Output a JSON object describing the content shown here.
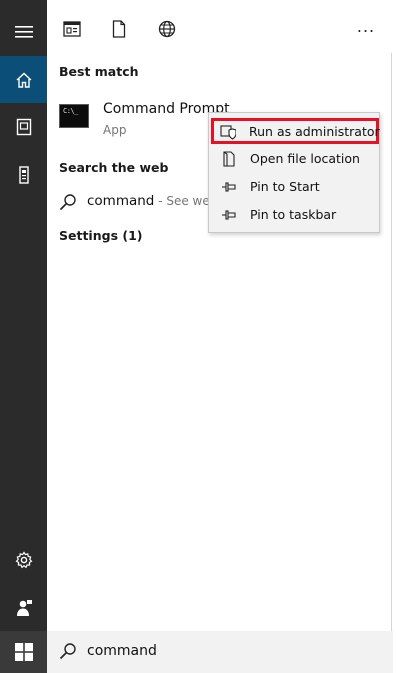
{
  "sidebar": {
    "items": [
      {
        "icon": "hamburger-menu-icon"
      },
      {
        "icon": "home-icon",
        "active": true
      },
      {
        "icon": "documents-icon"
      },
      {
        "icon": "device-icon"
      },
      {
        "icon": "gear-icon"
      },
      {
        "icon": "user-feedback-icon"
      }
    ],
    "start_icon": "windows-logo-icon",
    "active_color": "#0b4e78",
    "background": "#2b2b2b"
  },
  "topbar": {
    "icons": [
      "apps-icon",
      "document-icon",
      "web-globe-icon",
      "more-options-icon"
    ],
    "more_label": "..."
  },
  "best_match": {
    "header": "Best match",
    "app_name": "Command Prompt",
    "app_type": "App",
    "icon_text": "C:\\_"
  },
  "search_web": {
    "header": "Search the web",
    "query": "command",
    "suffix": " - See wel"
  },
  "settings": {
    "header": "Settings (1)"
  },
  "context_menu": {
    "items": [
      {
        "label": "Run as administrator",
        "icon": "shield-icon",
        "highlighted": true
      },
      {
        "label": "Open file location",
        "icon": "file-icon"
      },
      {
        "label": "Pin to Start",
        "icon": "pin-icon"
      },
      {
        "label": "Pin to taskbar",
        "icon": "pin-icon"
      }
    ],
    "highlight_color": "#e81123"
  },
  "search_box": {
    "value": "command"
  }
}
